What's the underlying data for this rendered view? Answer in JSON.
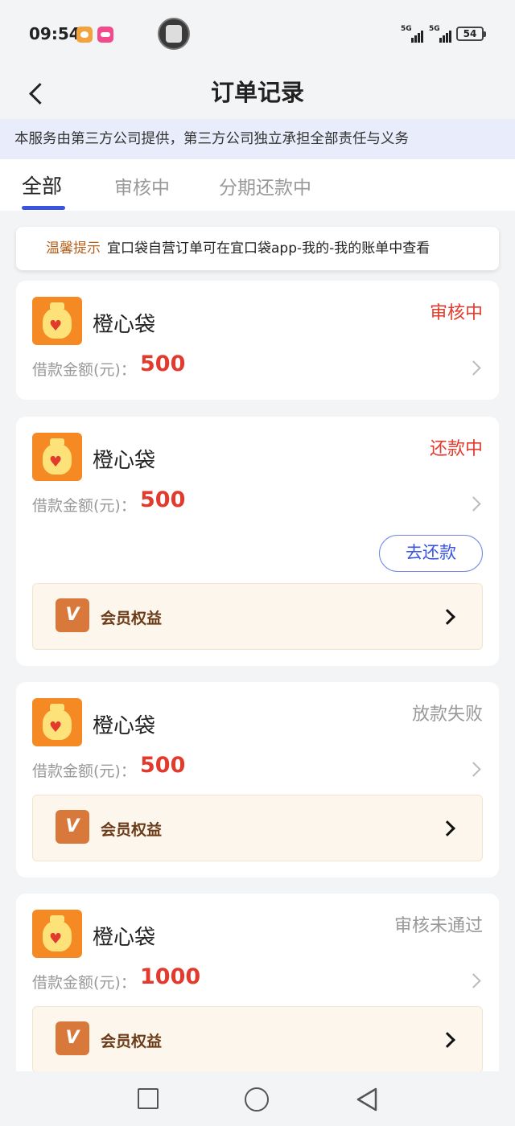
{
  "status_bar": {
    "time": "09:54",
    "network1": "5G",
    "network2": "5G",
    "battery": "54",
    "app_icons": [
      "heart-app-icon",
      "bilibili-app-icon"
    ]
  },
  "header": {
    "title": "订单记录",
    "back_icon": "chevron-left-icon"
  },
  "notice": "本服务由第三方公司提供，第三方公司独立承担全部责任与义务",
  "tabs": [
    {
      "label": "全部",
      "active": true
    },
    {
      "label": "审核中",
      "active": false
    },
    {
      "label": "分期还款中",
      "active": false
    }
  ],
  "tip": {
    "label": "温馨提示",
    "text": "宜口袋自营订单可在宜口袋app-我的-我的账单中查看"
  },
  "orders": [
    {
      "brand": "橙心袋",
      "status": "审核中",
      "status_color": "#e23b2e",
      "amount_label": "借款金额(元)：",
      "amount": "500"
    },
    {
      "brand": "橙心袋",
      "status": "还款中",
      "status_color": "#e23b2e",
      "amount_label": "借款金额(元)：",
      "amount": "500",
      "action": "去还款",
      "vip_label": "会员权益"
    },
    {
      "brand": "橙心袋",
      "status": "放款失败",
      "status_color": "#999999",
      "amount_label": "借款金额(元)：",
      "amount": "500",
      "vip_label": "会员权益"
    },
    {
      "brand": "橙心袋",
      "status": "审核未通过",
      "status_color": "#999999",
      "amount_label": "借款金额(元)：",
      "amount": "1000",
      "vip_label": "会员权益"
    }
  ],
  "vip_icon_text": "VIP",
  "colors": {
    "accent": "#3a54e0",
    "amount": "#e23b2e",
    "brand_orange": "#f58a24",
    "vip_bg": "#fdf6ec"
  },
  "nav": [
    "recents-square-icon",
    "home-circle-icon",
    "back-triangle-icon"
  ]
}
